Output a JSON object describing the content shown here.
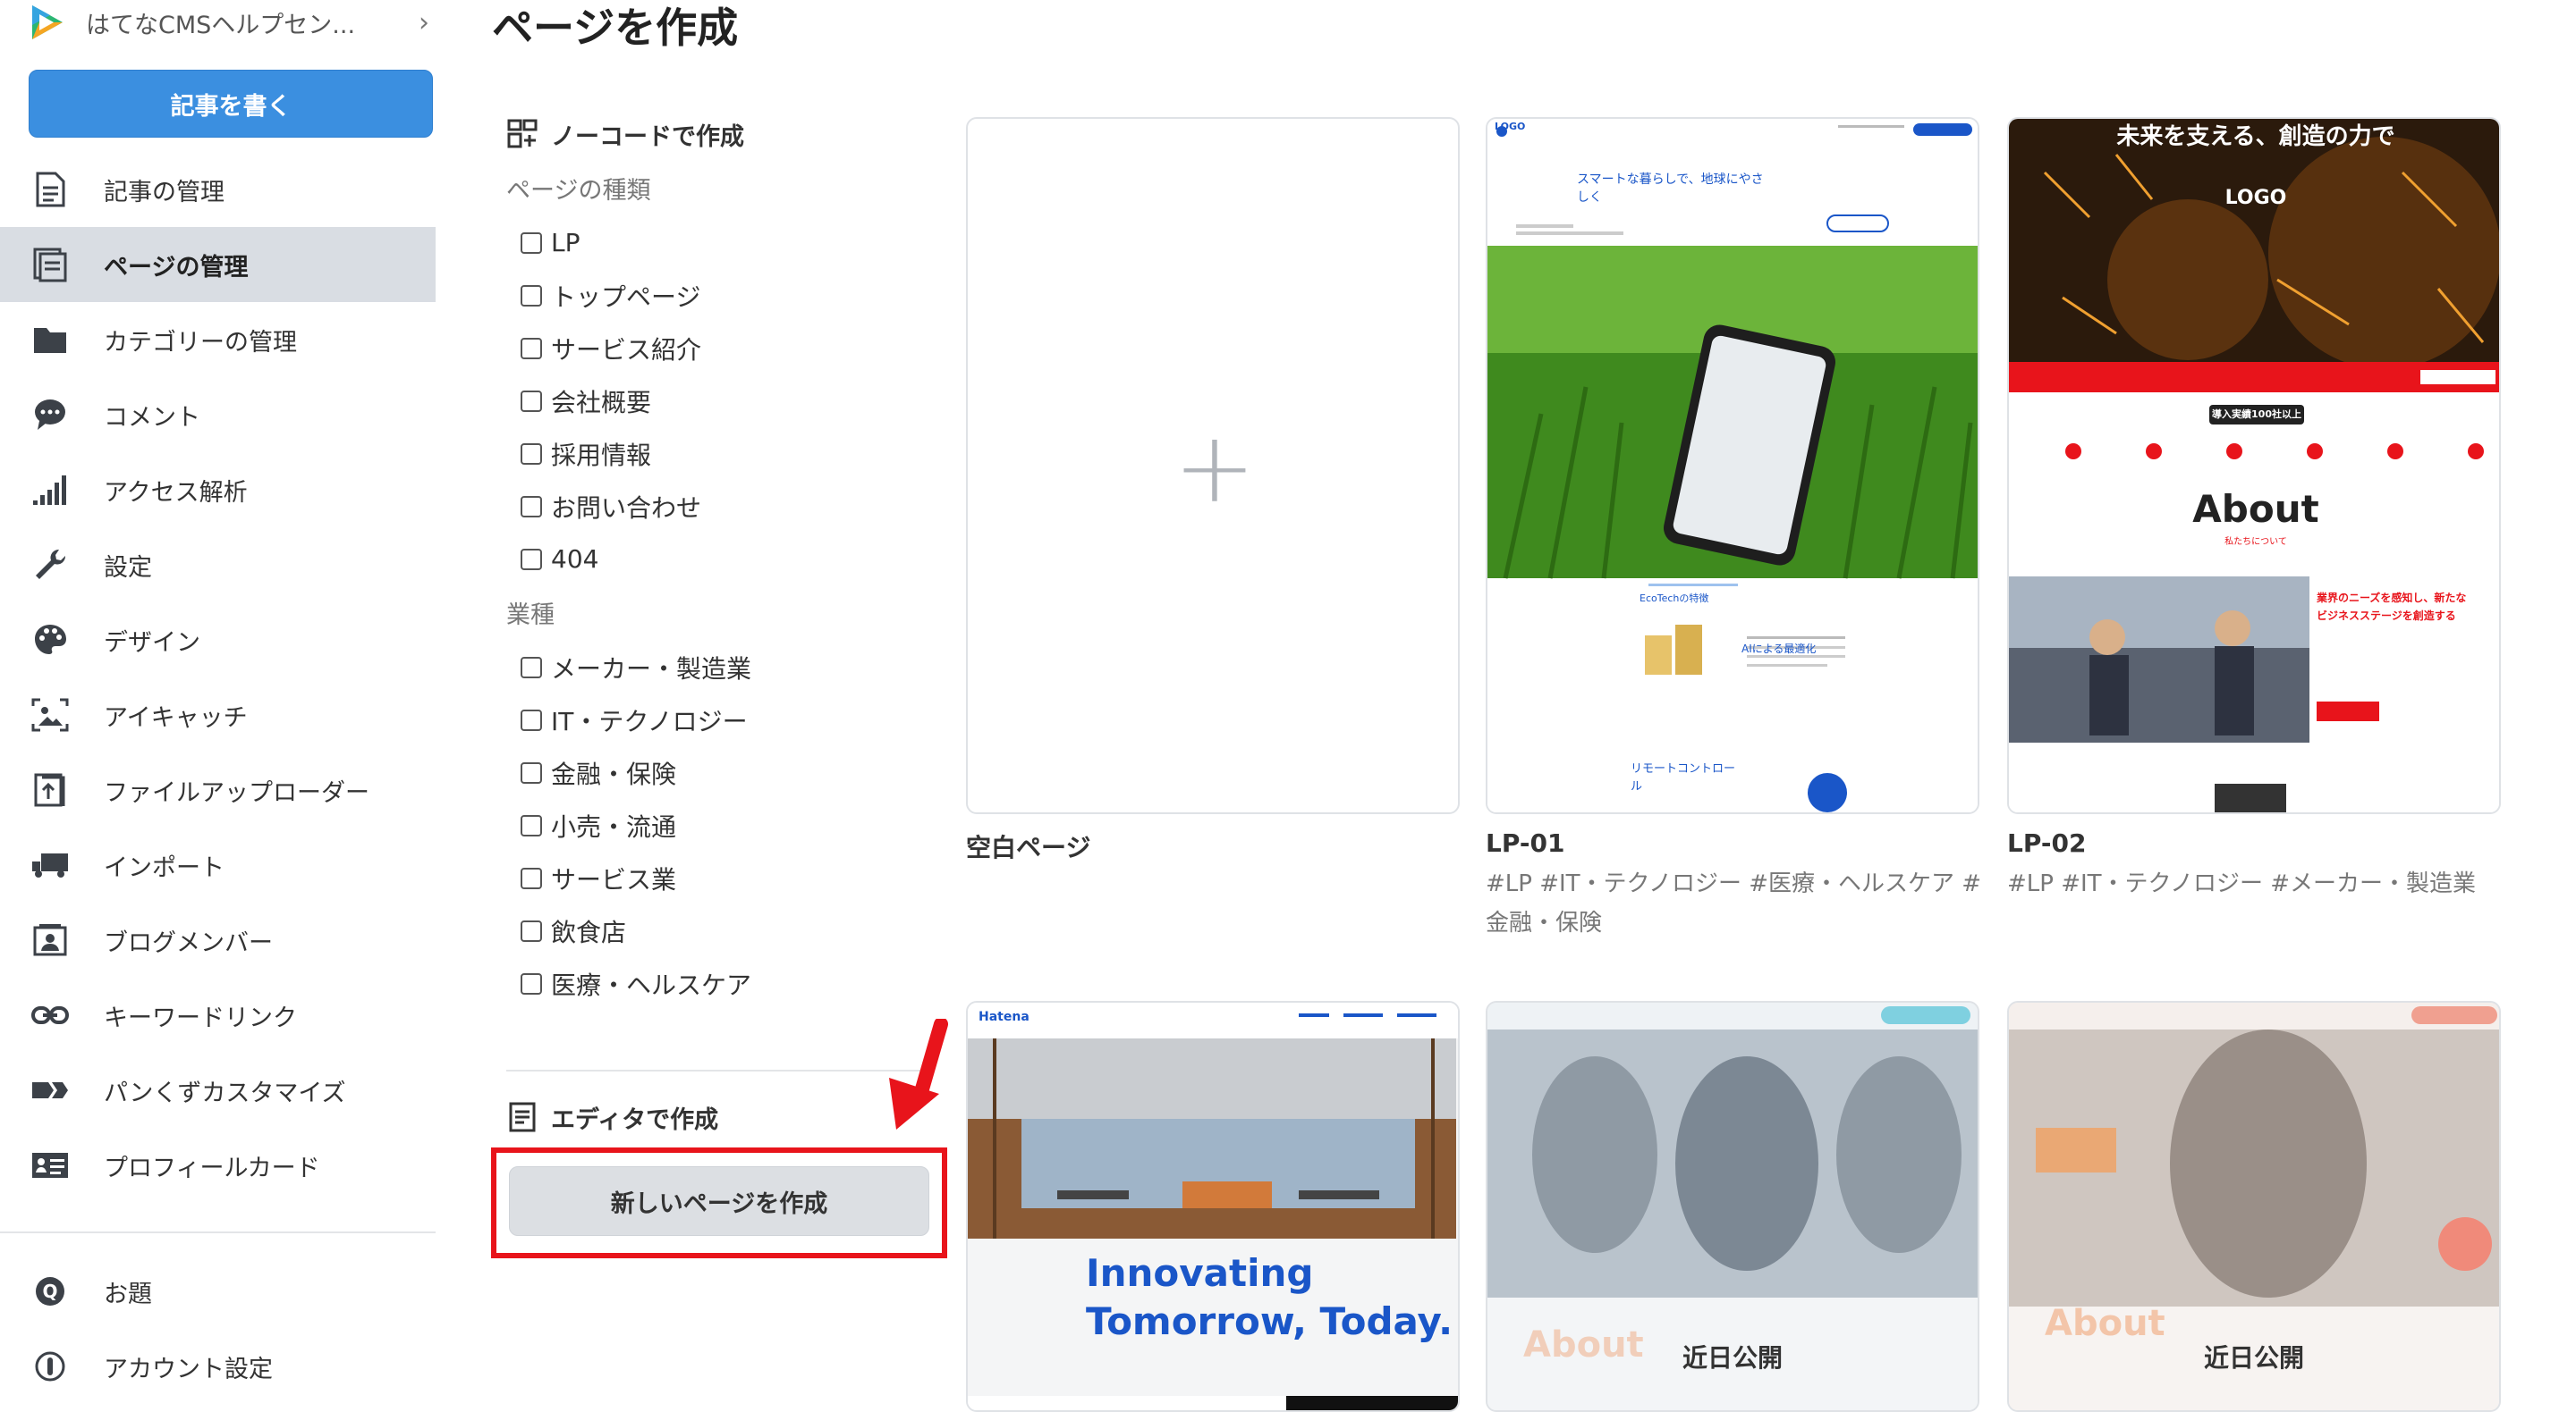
{
  "sidebar": {
    "blog_title": "はてなCMSヘルプセン...",
    "write_button": "記事を書く",
    "items": [
      {
        "label": "記事の管理",
        "icon": "document-icon"
      },
      {
        "label": "ページの管理",
        "icon": "pages-icon",
        "active": true
      },
      {
        "label": "カテゴリーの管理",
        "icon": "folder-icon"
      },
      {
        "label": "コメント",
        "icon": "comment-icon"
      },
      {
        "label": "アクセス解析",
        "icon": "bar-signal-icon"
      },
      {
        "label": "設定",
        "icon": "wrench-icon"
      },
      {
        "label": "デザイン",
        "icon": "palette-icon"
      },
      {
        "label": "アイキャッチ",
        "icon": "eyecatch-icon"
      },
      {
        "label": "ファイルアップローダー",
        "icon": "upload-icon"
      },
      {
        "label": "インポート",
        "icon": "truck-icon"
      },
      {
        "label": "ブログメンバー",
        "icon": "member-icon"
      },
      {
        "label": "キーワードリンク",
        "icon": "link-icon"
      },
      {
        "label": "パンくずカスタマイズ",
        "icon": "breadcrumb-icon"
      },
      {
        "label": "プロフィールカード",
        "icon": "profile-card-icon"
      }
    ],
    "bottom_items": [
      {
        "label": "お題",
        "icon": "question-icon"
      },
      {
        "label": "アカウント設定",
        "icon": "account-icon"
      }
    ]
  },
  "page_title": "ページを作成",
  "filters": {
    "nocode_heading": "ノーコードで作成",
    "page_type_label": "ページの種類",
    "page_types": [
      "LP",
      "トップページ",
      "サービス紹介",
      "会社概要",
      "採用情報",
      "お問い合わせ",
      "404"
    ],
    "industry_label": "業種",
    "industries": [
      "メーカー・製造業",
      "IT・テクノロジー",
      "金融・保険",
      "小売・流通",
      "サービス業",
      "飲食店",
      "医療・ヘルスケア"
    ],
    "editor_heading": "エディタで作成",
    "new_page_button": "新しいページを作成"
  },
  "templates": {
    "blank": {
      "title": "空白ページ"
    },
    "lp01": {
      "title": "LP-01",
      "tags": "#LP #IT・テクノロジー #医療・ヘルスケア #金融・保険",
      "preview": {
        "logo": "LOGO",
        "tagline": "スマートな暮らしで、地球にやさしく",
        "section": "EcoTechの特徴",
        "feature": "AIによる最適化",
        "remote": "リモートコントロール"
      }
    },
    "lp02": {
      "title": "LP-02",
      "tags": "#LP #IT・テクノロジー #メーカー・製造業",
      "preview": {
        "hero": "未来を支える、創造の力で",
        "logo": "LOGO",
        "badge": "導入実績100社以上",
        "about": "About",
        "about_sub": "私たちについて",
        "copy": "業界のニーズを感知し、新たなビジネスステージを創造する"
      }
    },
    "hatena": {
      "preview": {
        "brand": "Hatena",
        "headline1": "Innovating",
        "headline2": "Tomorrow, Today."
      }
    },
    "soon1": {
      "label": "近日公開",
      "ghost": "About"
    },
    "soon2": {
      "label": "近日公開",
      "ghost": "About"
    }
  }
}
